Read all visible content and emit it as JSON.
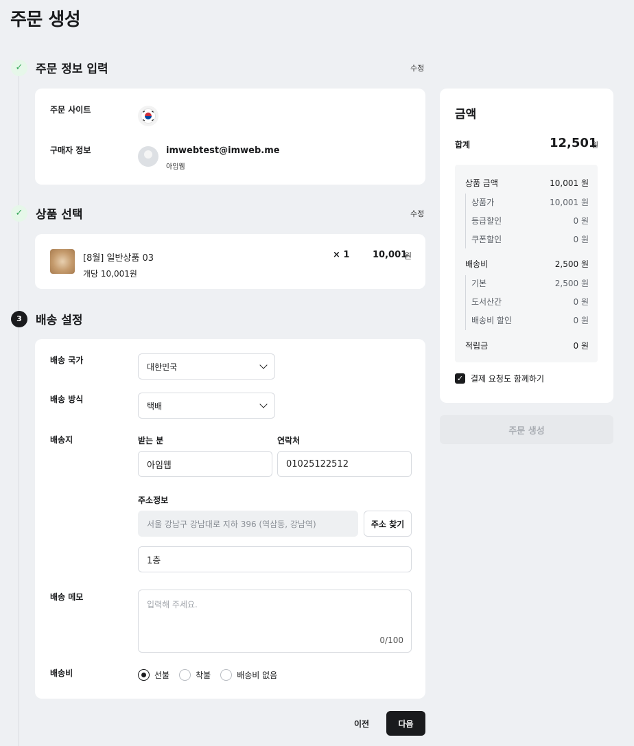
{
  "page": {
    "title": "주문 생성"
  },
  "steps": {
    "order_info": {
      "icon": "✓",
      "title": "주문 정보 입력",
      "edit": "수정"
    },
    "product": {
      "icon": "✓",
      "title": "상품 선택",
      "edit": "수정"
    },
    "shipping": {
      "number": "3",
      "title": "배송 설정"
    }
  },
  "order_info": {
    "site_label": "주문 사이트",
    "site_flag": "flag-korea-icon",
    "buyer_label": "구매자 정보",
    "buyer_email": "imwebtest@imweb.me",
    "buyer_name": "아임웹"
  },
  "product": {
    "name": "[8월] 일반상품 03",
    "unit_price": "개당 10,001원",
    "qty": "× 1",
    "price": "10,001",
    "currency": "원"
  },
  "shipping": {
    "country_label": "배송 국가",
    "country_value": "대한민국",
    "method_label": "배송 방식",
    "method_value": "택배",
    "address_label": "배송지",
    "recipient_label": "받는 분",
    "recipient_value": "아임웹",
    "phone_label": "연락처",
    "phone_value": "01025122512",
    "addr_info_label": "주소정보",
    "addr_value": "서울 강남구 강남대로 지하 396 (역삼동, 강남역)",
    "addr_search": "주소 찾기",
    "addr_detail": "1층",
    "memo_label": "배송 메모",
    "memo_placeholder": "입력해 주세요.",
    "memo_count": "0/100",
    "fee_label": "배송비",
    "fee_options": [
      "선불",
      "착불",
      "배송비 없음"
    ],
    "fee_selected": "선불"
  },
  "nav": {
    "prev": "이전",
    "next": "다음"
  },
  "summary": {
    "title": "금액",
    "total_label": "합계",
    "total_value": "12,501",
    "currency": "원",
    "rows": {
      "product_amount": {
        "label": "상품 금액",
        "value": "10,001 원"
      },
      "product_price": {
        "label": "상품가",
        "value": "10,001 원"
      },
      "grade_discount": {
        "label": "등급할인",
        "value": "0 원"
      },
      "coupon_discount": {
        "label": "쿠폰할인",
        "value": "0 원"
      },
      "shipping_fee": {
        "label": "배송비",
        "value": "2,500 원"
      },
      "base": {
        "label": "기본",
        "value": "2,500 원"
      },
      "island": {
        "label": "도서산간",
        "value": "0 원"
      },
      "shipping_discount": {
        "label": "배송비 할인",
        "value": "0 원"
      },
      "points": {
        "label": "적립금",
        "value": "0 원"
      }
    },
    "payment_request": "결제 요청도 함께하기",
    "payment_request_checked": true,
    "create_button": "주문 생성"
  }
}
